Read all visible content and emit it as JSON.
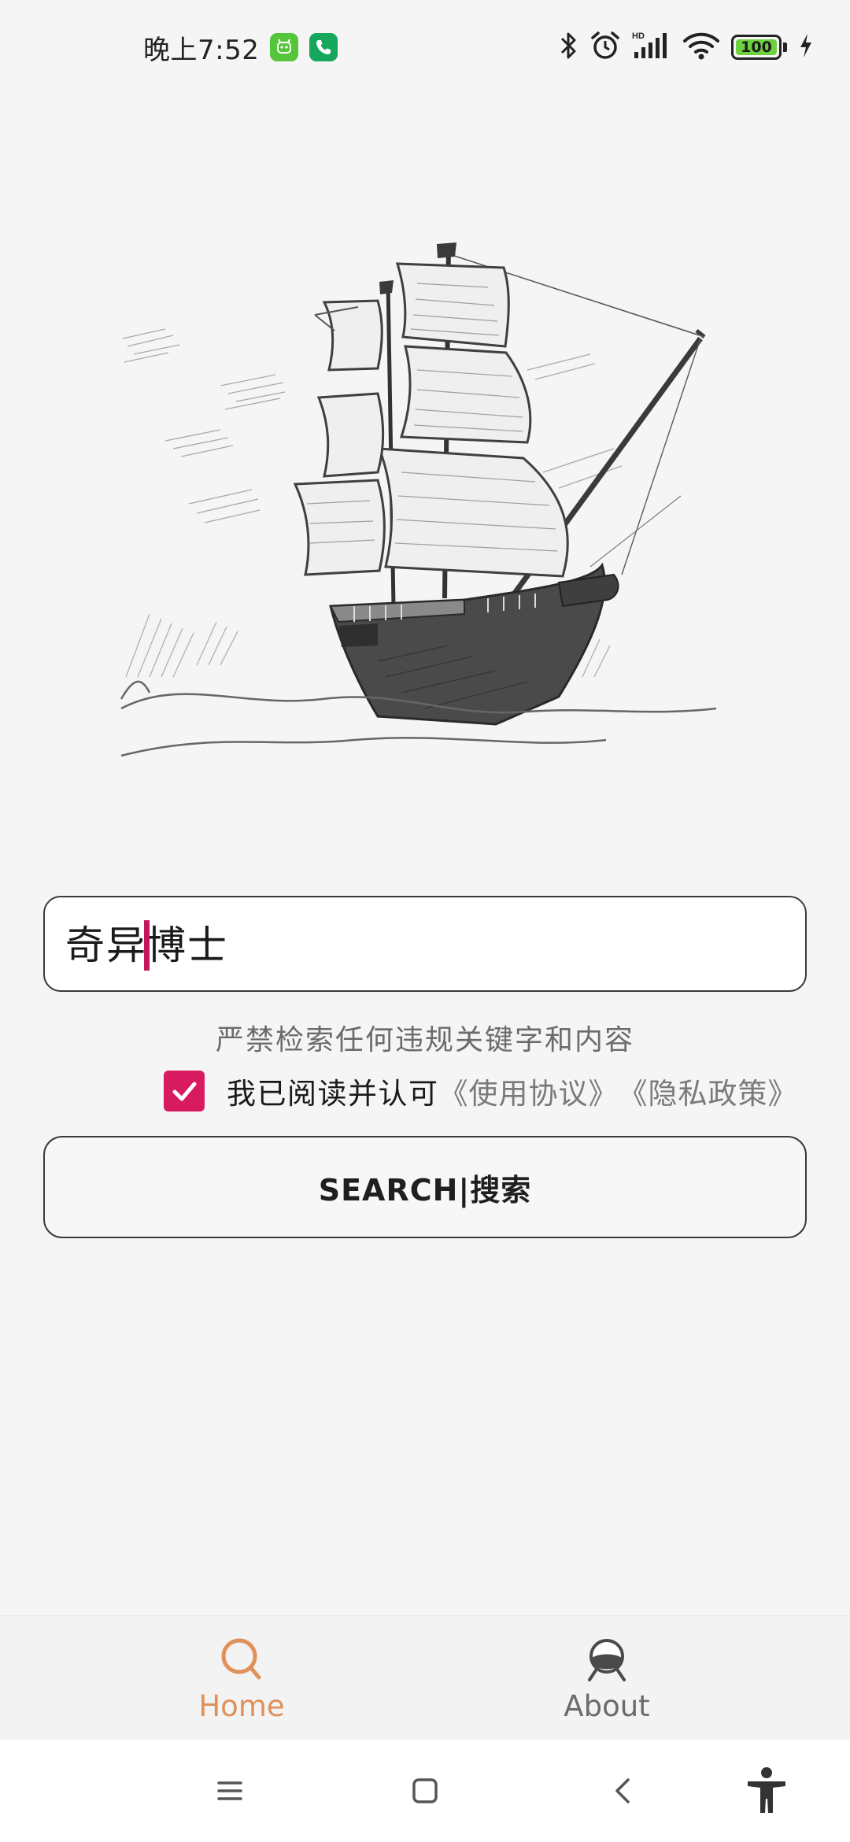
{
  "status_bar": {
    "time": "晚上7:52",
    "battery_level": "100",
    "icons": [
      "app-badge-icon",
      "phone-badge-icon",
      "bluetooth-icon",
      "alarm-icon",
      "hd-signal-icon",
      "wifi-icon",
      "battery-icon",
      "charging-icon"
    ]
  },
  "illustration": {
    "icon": "sailing-ship-sketch"
  },
  "search": {
    "value_before_cursor": "奇异",
    "value_after_cursor": "博士"
  },
  "warning": "严禁检索任何违规关键字和内容",
  "agreement": {
    "checked": true,
    "label": "我已阅读并认可",
    "terms_link": "《使用协议》",
    "privacy_link": "《隐私政策》"
  },
  "search_button": {
    "label": "SEARCH|搜索"
  },
  "bottom_nav": {
    "active": "Home",
    "items": [
      {
        "label": "Home",
        "icon": "search-icon",
        "color": "#e0915a"
      },
      {
        "label": "About",
        "icon": "boat-avatar-icon",
        "color": "#6b6b6b"
      }
    ]
  },
  "system_nav": {
    "icons": [
      "menu-icon",
      "home-square-icon",
      "back-icon",
      "accessibility-icon"
    ]
  },
  "colors": {
    "accent": "#d81b60",
    "nav_active": "#e0915a",
    "background": "#f5f5f5"
  }
}
